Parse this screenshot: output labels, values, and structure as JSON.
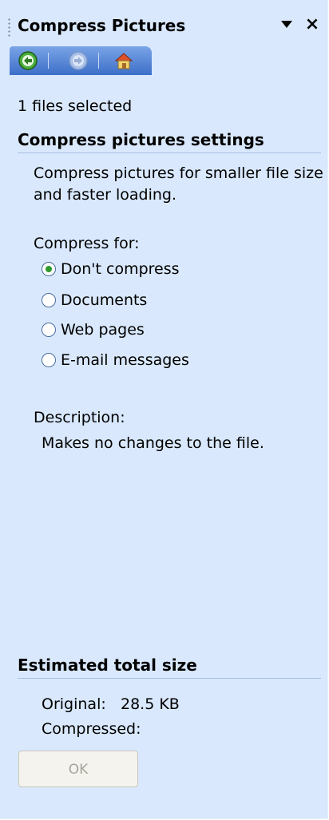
{
  "pane": {
    "title": "Compress Pictures"
  },
  "nav": {
    "back_icon": "back-arrow-icon",
    "forward_icon": "forward-arrow-icon",
    "home_icon": "home-icon"
  },
  "selection": {
    "status": "1 files selected"
  },
  "settings": {
    "heading": "Compress pictures settings",
    "intro_line1": "Compress pictures for smaller file size",
    "intro_line2": "and faster loading.",
    "compress_for_label": "Compress for:",
    "options": [
      {
        "label": "Don't compress",
        "selected": true
      },
      {
        "label": "Documents",
        "selected": false
      },
      {
        "label": "Web pages",
        "selected": false
      },
      {
        "label": "E-mail messages",
        "selected": false
      }
    ],
    "description_label": "Description:",
    "description_text": "Makes no changes to the file."
  },
  "estimate": {
    "heading": "Estimated total size",
    "original_label": "Original:",
    "original_value": "28.5 KB",
    "compressed_label": "Compressed:",
    "compressed_value": ""
  },
  "ok_button": {
    "label": "OK",
    "enabled": false
  }
}
